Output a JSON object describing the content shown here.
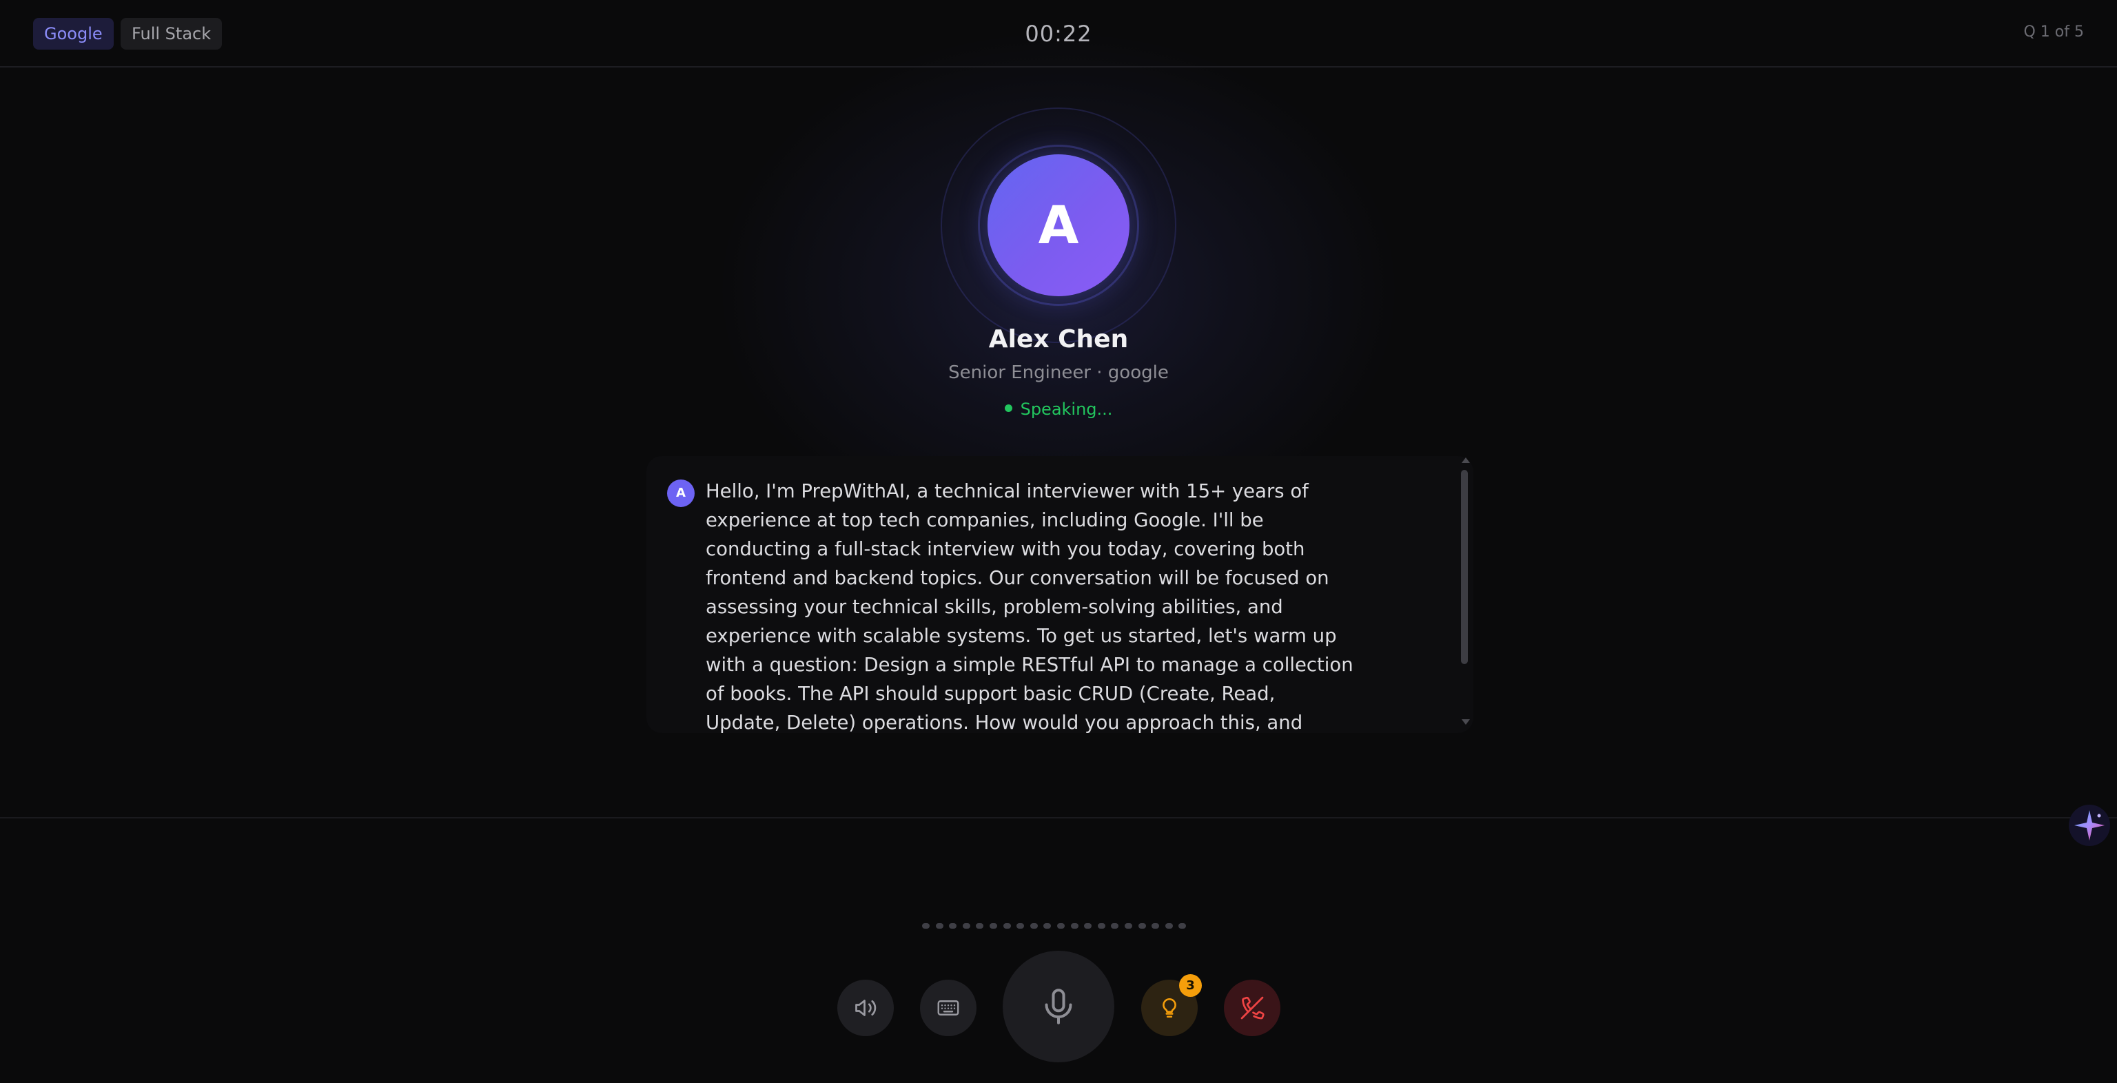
{
  "header": {
    "company": "Google",
    "track": "Full Stack",
    "timer": "00:22",
    "question_progress": "Q 1 of 5"
  },
  "interviewer": {
    "avatar_letter": "A",
    "name": "Alex Chen",
    "role": "Senior Engineer · google",
    "status": "Speaking..."
  },
  "transcript": {
    "messages": [
      {
        "sender_initial": "A",
        "text": "Hello, I'm PrepWithAI, a technical interviewer with 15+ years of experience at top tech companies, including Google. I'll be conducting a full-stack interview with you today, covering both frontend and backend topics. Our conversation will be focused on assessing your technical skills, problem-solving abilities, and experience with scalable systems. To get us started, let's warm up with a question: Design a simple RESTful API to manage a collection of books. The API should support basic CRUD (Create, Read, Update, Delete) operations. How would you approach this, and what endpoints would you define? Please share your"
      }
    ]
  },
  "controls": {
    "speaker": {
      "icon": "speaker-icon"
    },
    "keyboard": {
      "icon": "keyboard-icon"
    },
    "mic": {
      "icon": "microphone-icon"
    },
    "hints": {
      "icon": "lightbulb-icon",
      "badge_count": "3"
    },
    "end_call": {
      "icon": "phone-off-icon"
    }
  },
  "waveform": {
    "bar_count": 20
  },
  "colors": {
    "accent": "#6366f1",
    "accent_purple": "#8b5cf6",
    "status_green": "#22c55e",
    "hint_amber": "#f59e0b",
    "end_red": "#ef4444",
    "background": "#0a0a0b"
  }
}
